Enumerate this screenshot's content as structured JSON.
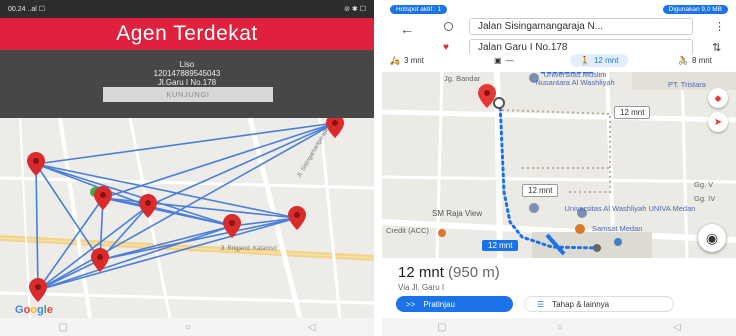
{
  "left": {
    "status": {
      "time": "00.24 ..al ☐",
      "icons": "⊘ ✱ ☐"
    },
    "title": "Agen Terdekat",
    "info": {
      "name": "Liso",
      "phone": "120147889545043",
      "address": "Jl.Garu I No.178"
    },
    "button_label": "KUNJUNGI",
    "map_labels": {
      "road1": "Jl. Sisingamangaraja",
      "road2": "Jl. Brigjend. Katamso",
      "logo": "Google"
    }
  },
  "right": {
    "status": {
      "hotspot": "Hotspot aktif : 1",
      "data": "Digunakan 9,0 MB"
    },
    "origin": "Jalan Sisingamangaraja N...",
    "destination": "Jalan Garu I No.178",
    "modes": [
      {
        "icon": "motorbike-icon",
        "label": "3 mnt"
      },
      {
        "icon": "transit-icon",
        "label": "—"
      },
      {
        "icon": "walk-icon",
        "label": "12 mnt"
      },
      {
        "icon": "cycle-icon",
        "label": "8 mnt"
      }
    ],
    "map_labels": {
      "place1": "Universitas Muslim Nusantara Al Washliyah",
      "place2": "PT. Tristara",
      "place3": "SM Raja View",
      "place4": "Universitas Al Washliyah UNIVA Medan",
      "place5": "Samsat Medan",
      "place6": "Credit (ACC)",
      "street1": "Jg. Bandar",
      "gg1": "Gg. V",
      "gg2": "Gg. IV"
    },
    "route_tags": {
      "tag1": "12 mnt",
      "tag2": "12 mnt",
      "tag3": "12 mnt"
    },
    "summary": {
      "time": "12 mnt",
      "distance": "(950 m)",
      "via": "Via Jl. Garu I"
    },
    "buttons": {
      "preview": "Pratinjau",
      "steps": "Tahap & lainnya"
    }
  },
  "colors": {
    "accent_red": "#e0213d",
    "route_blue": "#1a73e8",
    "pin_red": "#d92b2b"
  }
}
